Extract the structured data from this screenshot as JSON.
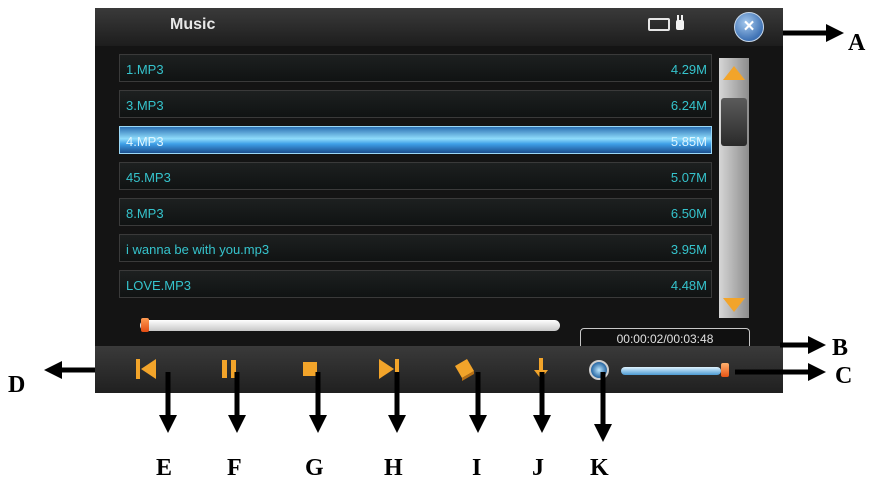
{
  "window": {
    "title": "Music",
    "close_icon": "x-icon"
  },
  "status": {
    "battery_icon": "battery-icon",
    "power_icon": "plug-icon"
  },
  "playlist": {
    "items": [
      {
        "name": "1.MP3",
        "size": "4.29M",
        "selected": false
      },
      {
        "name": "3.MP3",
        "size": "6.24M",
        "selected": false
      },
      {
        "name": "4.MP3",
        "size": "5.85M",
        "selected": true
      },
      {
        "name": "45.MP3",
        "size": "5.07M",
        "selected": false
      },
      {
        "name": "8.MP3",
        "size": "6.50M",
        "selected": false
      },
      {
        "name": "i wanna be with you.mp3",
        "size": "3.95M",
        "selected": false
      },
      {
        "name": "LOVE.MP3",
        "size": "4.48M",
        "selected": false
      }
    ]
  },
  "playback": {
    "time": "00:00:02/00:03:48",
    "progress_fraction": 0.01,
    "volume_fraction": 1.0
  },
  "controls": [
    "prev-icon",
    "pause-icon",
    "stop-icon",
    "next-icon",
    "book-icon",
    "download-icon"
  ],
  "callout_labels": {
    "A": "A",
    "B": "B",
    "C": "C",
    "D": "D",
    "E": "E",
    "F": "F",
    "G": "G",
    "H": "H",
    "I": "I",
    "J": "J",
    "K": "K"
  },
  "colors": {
    "accent": "#f2a42a",
    "text": "#35c3cc",
    "selected": "#5fc0f5"
  }
}
